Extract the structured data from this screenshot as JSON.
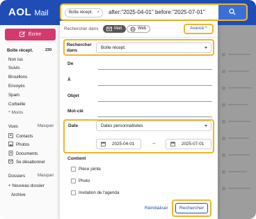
{
  "brand": {
    "name": "AOL",
    "product": "Mail"
  },
  "search": {
    "scope_chip": "Boîte récept.",
    "chip_close": "×",
    "query": "after:\"2025-04-01\" before:\"2025-07-01\""
  },
  "sidebar": {
    "compose_label": "Écrire",
    "inbox_label": "Boîte récept.",
    "inbox_count": "230",
    "folders": [
      "Non lus",
      "Suivis",
      "Brouillons",
      "Envoyés",
      "Spam",
      "Corbeille"
    ],
    "less_label": "^ Moins",
    "views_label": "Vues",
    "views_hide": "Masquer",
    "views": [
      "Contacts",
      "Photos",
      "Documents",
      "Se désabonner"
    ],
    "folders_label": "Dossiers",
    "folders_hide": "Masquer",
    "new_folder": "+ Nouveau dossier",
    "archive": "Archive"
  },
  "panel": {
    "search_in_label": "Rechercher dans",
    "mail_toggle": "Mail",
    "web_toggle": "Web",
    "advanced_label": "Avancé ^",
    "search_in_field_label": "Rechercher dans",
    "search_in_value": "Boîte récept.",
    "from_label": "De",
    "to_label": "À",
    "subject_label": "Objet",
    "keyword_label": "Mot-clé",
    "date_label": "Date",
    "date_value": "Dates personnalisées",
    "date_start": "2025-04-01",
    "date_arrow": "→",
    "date_end": "2025-07-01",
    "contains_label": "Contient",
    "options": [
      "Pièce jointe",
      "Photo",
      "Invitation de l'agenda"
    ],
    "reset_label": "Réinitialiser",
    "submit_label": "Rechercher"
  },
  "colors": {
    "header": "#1f4db5",
    "compose": "#d33a6e",
    "highlight": "#f0b429",
    "link": "#1f4db5"
  }
}
